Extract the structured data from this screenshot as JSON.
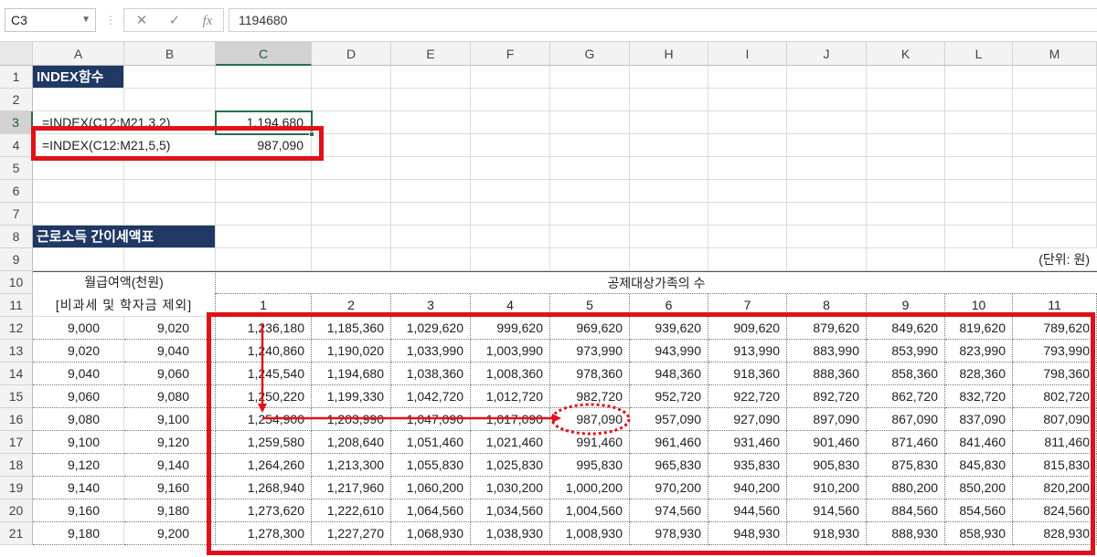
{
  "formula_bar": {
    "name_box": "C3",
    "formula": "1194680",
    "cancel_icon": "✕",
    "enter_icon": "✓",
    "fx_icon": "fx"
  },
  "columns": [
    "A",
    "B",
    "C",
    "D",
    "E",
    "F",
    "G",
    "H",
    "I",
    "J",
    "K",
    "L",
    "M"
  ],
  "rows": [
    "1",
    "2",
    "3",
    "4",
    "5",
    "6",
    "7",
    "8",
    "9",
    "10",
    "11",
    "12",
    "13",
    "14",
    "15",
    "16",
    "17",
    "18",
    "19",
    "20",
    "21"
  ],
  "sheet": {
    "title1": "INDEX함수",
    "formula_a3": "=INDEX(C12:M21,3,2)",
    "value_c3": "1,194,680",
    "formula_a4": "=INDEX(C12:M21,5,5)",
    "value_c4": "987,090",
    "title2": "근로소득 간이세액표",
    "unit": "(단위: 원)",
    "salary_header": "월급여액(천원)",
    "salary_sub": "[비과세 및 학자금 제외]",
    "family_header": "공제대상가족의 수",
    "family_counts": [
      "1",
      "2",
      "3",
      "4",
      "5",
      "6",
      "7",
      "8",
      "9",
      "10",
      "11"
    ]
  },
  "table": [
    {
      "from": "9,000",
      "to": "9,020",
      "vals": [
        "1,236,180",
        "1,185,360",
        "1,029,620",
        "999,620",
        "969,620",
        "939,620",
        "909,620",
        "879,620",
        "849,620",
        "819,620",
        "789,620"
      ]
    },
    {
      "from": "9,020",
      "to": "9,040",
      "vals": [
        "1,240,860",
        "1,190,020",
        "1,033,990",
        "1,003,990",
        "973,990",
        "943,990",
        "913,990",
        "883,990",
        "853,990",
        "823,990",
        "793,990"
      ]
    },
    {
      "from": "9,040",
      "to": "9,060",
      "vals": [
        "1,245,540",
        "1,194,680",
        "1,038,360",
        "1,008,360",
        "978,360",
        "948,360",
        "918,360",
        "888,360",
        "858,360",
        "828,360",
        "798,360"
      ]
    },
    {
      "from": "9,060",
      "to": "9,080",
      "vals": [
        "1,250,220",
        "1,199,330",
        "1,042,720",
        "1,012,720",
        "982,720",
        "952,720",
        "922,720",
        "892,720",
        "862,720",
        "832,720",
        "802,720"
      ]
    },
    {
      "from": "9,080",
      "to": "9,100",
      "vals": [
        "1,254,900",
        "1,203,990",
        "1,047,090",
        "1,017,090",
        "987,090",
        "957,090",
        "927,090",
        "897,090",
        "867,090",
        "837,090",
        "807,090"
      ]
    },
    {
      "from": "9,100",
      "to": "9,120",
      "vals": [
        "1,259,580",
        "1,208,640",
        "1,051,460",
        "1,021,460",
        "991,460",
        "961,460",
        "931,460",
        "901,460",
        "871,460",
        "841,460",
        "811,460"
      ]
    },
    {
      "from": "9,120",
      "to": "9,140",
      "vals": [
        "1,264,260",
        "1,213,300",
        "1,055,830",
        "1,025,830",
        "995,830",
        "965,830",
        "935,830",
        "905,830",
        "875,830",
        "845,830",
        "815,830"
      ]
    },
    {
      "from": "9,140",
      "to": "9,160",
      "vals": [
        "1,268,940",
        "1,217,960",
        "1,060,200",
        "1,030,200",
        "1,000,200",
        "970,200",
        "940,200",
        "910,200",
        "880,200",
        "850,200",
        "820,200"
      ]
    },
    {
      "from": "9,160",
      "to": "9,180",
      "vals": [
        "1,273,620",
        "1,222,610",
        "1,064,560",
        "1,034,560",
        "1,004,560",
        "974,560",
        "944,560",
        "914,560",
        "884,560",
        "854,560",
        "824,560"
      ]
    },
    {
      "from": "9,180",
      "to": "9,200",
      "vals": [
        "1,278,300",
        "1,227,270",
        "1,068,930",
        "1,038,930",
        "1,008,930",
        "978,930",
        "948,930",
        "918,930",
        "888,930",
        "858,930",
        "828,930"
      ]
    }
  ],
  "colors": {
    "accent_red": "#e0111a",
    "title_band": "#1f3864",
    "selection_green": "#217346"
  }
}
